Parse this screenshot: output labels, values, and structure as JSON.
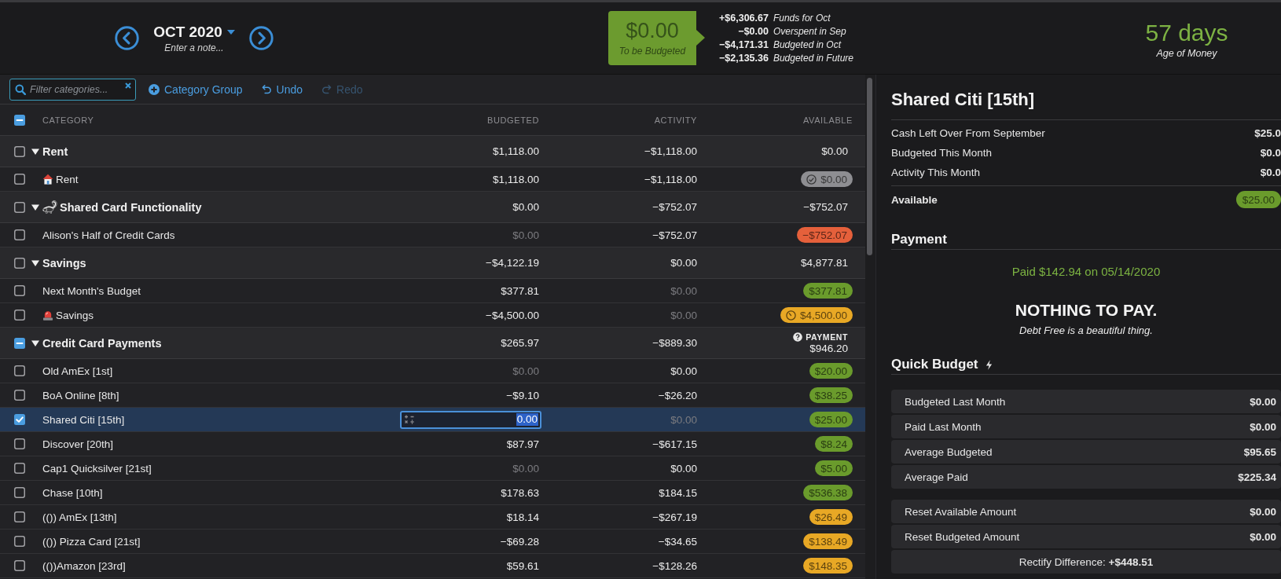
{
  "month_nav": {
    "month": "OCT 2020",
    "note": {
      "placeholder": "Enter a note..."
    }
  },
  "to_be_budgeted": {
    "amount": "$0.00",
    "label": "To be Budgeted"
  },
  "funds_summary": [
    {
      "amount": "+$6,306.67",
      "label": "Funds for Oct"
    },
    {
      "amount": "−$0.00",
      "label": "Overspent in Sep"
    },
    {
      "amount": "−$4,171.31",
      "label": "Budgeted in Oct"
    },
    {
      "amount": "−$2,135.36",
      "label": "Budgeted in Future"
    }
  ],
  "age_of_money": {
    "value": "57 days",
    "label": "Age of Money"
  },
  "toolbar": {
    "filter": {
      "placeholder": "Filter categories..."
    },
    "buttons": [
      {
        "label": "Category Group",
        "kind": "add",
        "disabled": false
      },
      {
        "label": "Undo",
        "kind": "undo",
        "disabled": false
      },
      {
        "label": "Redo",
        "kind": "redo",
        "disabled": true
      }
    ]
  },
  "table": {
    "select_all": {
      "checked": false,
      "mixed": true
    },
    "columns": [
      "CATEGORY",
      "BUDGETED",
      "ACTIVITY",
      "AVAILABLE"
    ],
    "groups": [
      {
        "name": "Rent",
        "checked": false,
        "mixed": false,
        "expanded": true,
        "budgeted": "$1,118.00",
        "activity": "−$1,118.00",
        "available": {
          "kind": "text",
          "text": "$0.00"
        },
        "items": [
          {
            "name": "Rent",
            "checked": false,
            "selected": false,
            "editing": false,
            "budgeted": {
              "text": "$1,118.00",
              "muted": false
            },
            "activity": {
              "text": "−$1,118.00",
              "muted": false
            },
            "available": {
              "kind": "pill_check",
              "text": "$0.00",
              "color": "#8e8e92"
            }
          }
        ]
      },
      {
        "name": "Shared Card Functionality",
        "checked": false,
        "mixed": false,
        "expanded": true,
        "budgeted": "$0.00",
        "activity": "−$752.07",
        "available": {
          "kind": "text",
          "text": "−$752.07"
        },
        "items": [
          {
            "name": "Alison's Half of Credit Cards",
            "checked": false,
            "selected": false,
            "editing": false,
            "budgeted": {
              "text": "$0.00",
              "muted": true
            },
            "activity": {
              "text": "−$752.07",
              "muted": false
            },
            "available": {
              "kind": "pill",
              "text": "−$752.07",
              "color": "#e5603b"
            }
          }
        ]
      },
      {
        "name": "Savings",
        "checked": false,
        "mixed": false,
        "expanded": true,
        "budgeted": "−$4,122.19",
        "activity": "$0.00",
        "available": {
          "kind": "text",
          "text": "$4,877.81"
        },
        "items": [
          {
            "name": "Next Month's Budget",
            "checked": false,
            "selected": false,
            "editing": false,
            "budgeted": {
              "text": "$377.81",
              "muted": false
            },
            "activity": {
              "text": "$0.00",
              "muted": true
            },
            "available": {
              "kind": "pill",
              "text": "$377.81",
              "color": "#6a9b2c"
            }
          },
          {
            "name": "Savings",
            "checked": false,
            "selected": false,
            "editing": false,
            "budgeted": {
              "text": "−$4,500.00",
              "muted": false
            },
            "activity": {
              "text": "$0.00",
              "muted": true
            },
            "available": {
              "kind": "pill_clock",
              "text": "$4,500.00",
              "color": "#e8a825"
            }
          }
        ]
      },
      {
        "name": "Credit Card Payments",
        "checked": false,
        "mixed": true,
        "expanded": true,
        "budgeted": "$265.97",
        "activity": "−$889.30",
        "available": {
          "kind": "payment",
          "label": "PAYMENT",
          "text": "$946.20"
        },
        "items": [
          {
            "name": "Old AmEx [1st]",
            "checked": false,
            "selected": false,
            "editing": false,
            "budgeted": {
              "text": "$0.00",
              "muted": true
            },
            "activity": {
              "text": "$0.00",
              "muted": false
            },
            "available": {
              "kind": "pill",
              "text": "$20.00",
              "color": "#6a9b2c"
            }
          },
          {
            "name": "BoA Online [8th]",
            "checked": false,
            "selected": false,
            "editing": false,
            "budgeted": {
              "text": "−$9.10",
              "muted": false
            },
            "activity": {
              "text": "−$26.20",
              "muted": false
            },
            "available": {
              "kind": "pill",
              "text": "$38.25",
              "color": "#6a9b2c"
            }
          },
          {
            "name": "Shared Citi [15th]",
            "checked": true,
            "selected": true,
            "editing": true,
            "budgeted": {
              "text": "0.00",
              "muted": false
            },
            "activity": {
              "text": "$0.00",
              "muted": true
            },
            "available": {
              "kind": "pill",
              "text": "$25.00",
              "color": "#6a9b2c"
            }
          },
          {
            "name": "Discover [20th]",
            "checked": false,
            "selected": false,
            "editing": false,
            "budgeted": {
              "text": "$87.97",
              "muted": false
            },
            "activity": {
              "text": "−$617.15",
              "muted": false
            },
            "available": {
              "kind": "pill",
              "text": "$8.24",
              "color": "#6a9b2c"
            }
          },
          {
            "name": "Cap1 Quicksilver [21st]",
            "checked": false,
            "selected": false,
            "editing": false,
            "budgeted": {
              "text": "$0.00",
              "muted": true
            },
            "activity": {
              "text": "$0.00",
              "muted": false
            },
            "available": {
              "kind": "pill",
              "text": "$5.00",
              "color": "#6a9b2c"
            }
          },
          {
            "name": "Chase [10th]",
            "checked": false,
            "selected": false,
            "editing": false,
            "budgeted": {
              "text": "$178.63",
              "muted": false
            },
            "activity": {
              "text": "$184.15",
              "muted": false
            },
            "available": {
              "kind": "pill",
              "text": "$536.38",
              "color": "#6a9b2c"
            }
          },
          {
            "name": "(()) AmEx [13th]",
            "checked": false,
            "selected": false,
            "editing": false,
            "budgeted": {
              "text": "$18.14",
              "muted": false
            },
            "activity": {
              "text": "−$267.19",
              "muted": false
            },
            "available": {
              "kind": "pill",
              "text": "$26.49",
              "color": "#e8a825"
            }
          },
          {
            "name": "(()) Pizza Card [21st]",
            "checked": false,
            "selected": false,
            "editing": false,
            "budgeted": {
              "text": "−$69.28",
              "muted": false
            },
            "activity": {
              "text": "−$34.65",
              "muted": false
            },
            "available": {
              "kind": "pill",
              "text": "$138.49",
              "color": "#e8a825"
            }
          },
          {
            "name": "(())Amazon [23rd]",
            "checked": false,
            "selected": false,
            "editing": false,
            "budgeted": {
              "text": "$59.61",
              "muted": false
            },
            "activity": {
              "text": "−$128.26",
              "muted": false
            },
            "available": {
              "kind": "pill",
              "text": "$148.35",
              "color": "#e8a825"
            }
          }
        ]
      }
    ]
  },
  "inspector": {
    "title": "Shared Citi [15th]",
    "stats": [
      {
        "label": "Cash Left Over From September",
        "value": "$25.0"
      },
      {
        "label": "Budgeted This Month",
        "value": "$0.0"
      },
      {
        "label": "Activity This Month",
        "value": "$0.0"
      }
    ],
    "available": {
      "label": "Available",
      "value": "$25.00",
      "color": "#6a9b2c"
    },
    "payment": {
      "heading": "Payment",
      "status": "Paid $142.94 on 05/14/2020",
      "headline": "NOTHING TO PAY.",
      "message": "Debt Free is a beautiful thing."
    },
    "quick_budget": {
      "heading": "Quick Budget",
      "sections": [
        [
          {
            "label": "Budgeted Last Month",
            "value": "$0.00"
          },
          {
            "label": "Paid Last Month",
            "value": "$0.00"
          },
          {
            "label": "Average Budgeted",
            "value": "$95.65"
          },
          {
            "label": "Average Paid",
            "value": "$225.34"
          }
        ],
        [
          {
            "label": "Reset Available Amount",
            "value": "$0.00"
          },
          {
            "label": "Reset Budgeted Amount",
            "value": "$0.00"
          }
        ]
      ],
      "rectify": "Rectify Difference: **+$448.51**"
    }
  }
}
